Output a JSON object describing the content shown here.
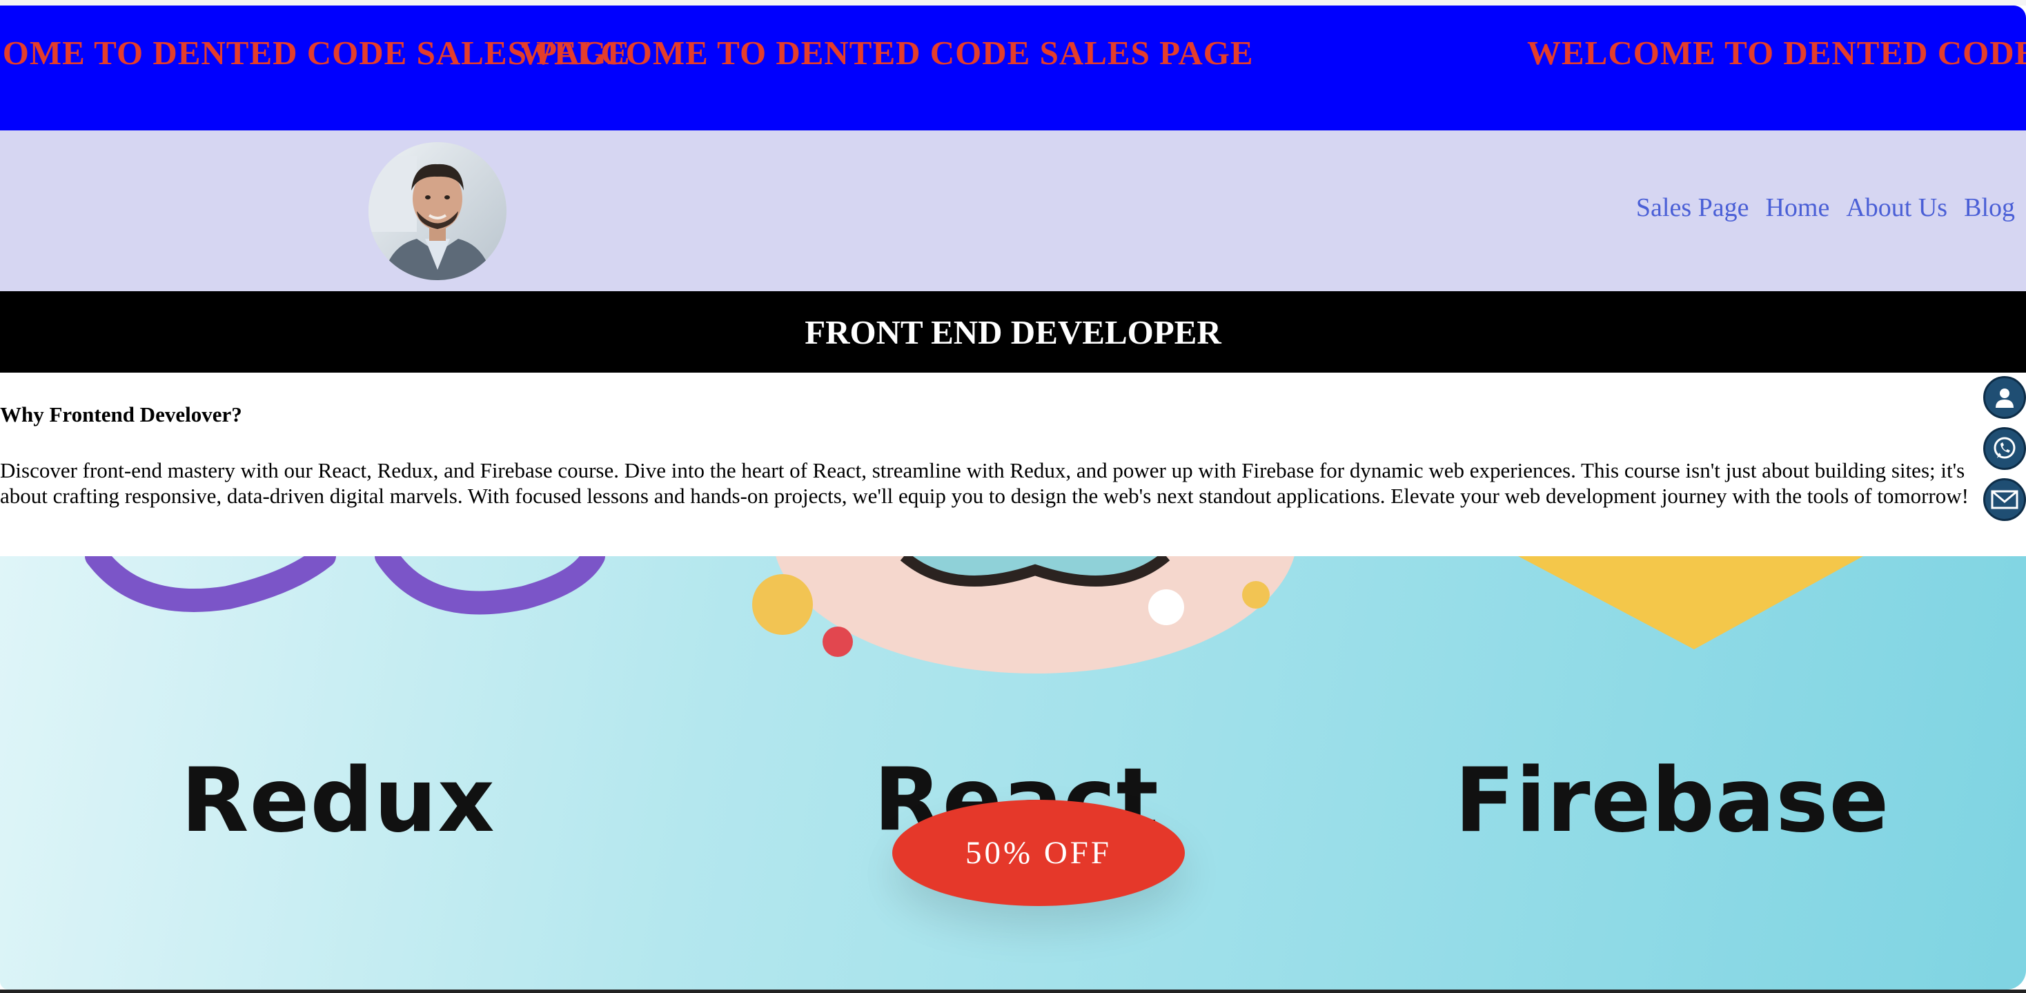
{
  "banner": {
    "marquee_text": "WELCOME TO DENTED CODE SALES PAGE"
  },
  "header": {
    "avatar_alt": "Profile photo",
    "nav": [
      {
        "label": "Sales Page"
      },
      {
        "label": "Home"
      },
      {
        "label": "About Us"
      },
      {
        "label": "Blog"
      }
    ]
  },
  "main": {
    "title": "FRONT END DEVELOPER",
    "section_heading": "Why Frontend Develover?",
    "section_body": "Discover front-end mastery with our React, Redux, and Firebase course. Dive into the heart of React, streamline with Redux, and power up with Firebase for dynamic web experiences. This course isn't just about building sites; it's about crafting responsive, data-driven digital marvels. With focused lessons and hands-on projects, we'll equip you to design the web's next standout applications. Elevate your web development journey with the tools of tomorrow!"
  },
  "hero": {
    "words": [
      "Redux",
      "React",
      "Firebase"
    ],
    "offer_label": "50% OFF"
  },
  "social": {
    "icons": [
      "user-icon",
      "whatsapp-icon",
      "mail-icon"
    ]
  },
  "colors": {
    "banner_bg": "#0000fe",
    "banner_text": "#e43d2b",
    "nav_bg": "#d6d6f2",
    "nav_link": "#4a5fd6",
    "offer_bg": "#e5382a",
    "social_bg": "#1f4e73"
  }
}
